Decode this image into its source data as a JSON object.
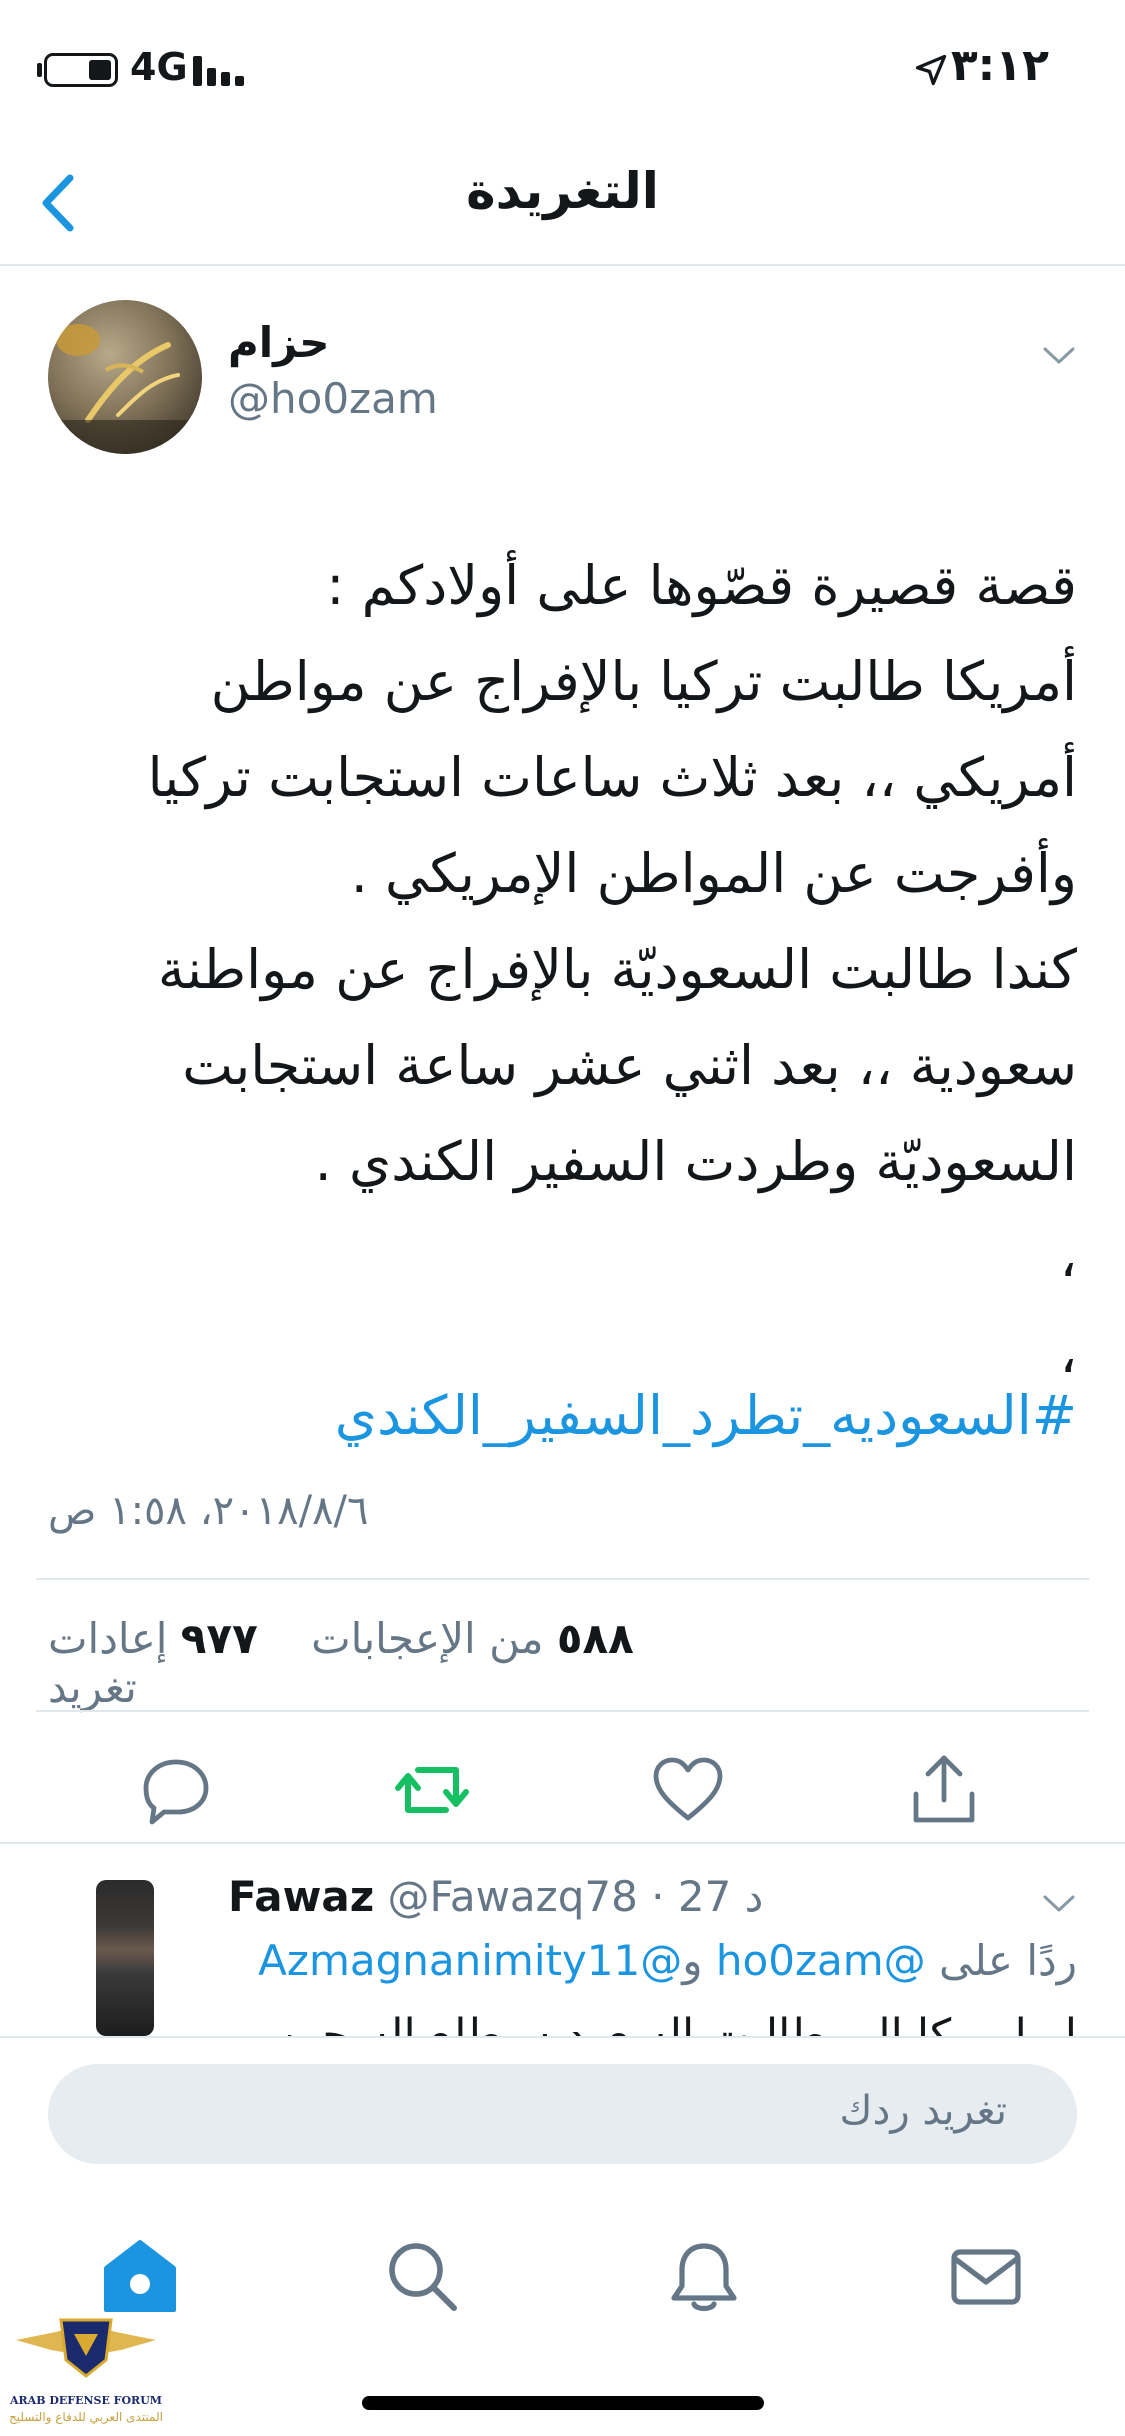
{
  "status_bar": {
    "network": "4G",
    "time": "٣:١٢"
  },
  "nav": {
    "title": "التغريدة"
  },
  "tweet": {
    "display_name": "حزام",
    "handle": "@ho0zam",
    "text": "قصة قصيرة قصّوها على أولادكم :\nأمريكا طالبت تركيا بالإفراج عن مواطن\nأمريكي ،، بعد ثلاث ساعات استجابت تركيا\nوأفرجت عن المواطن الإمريكي .\nكندا طالبت السعوديّة بالإفراج عن مواطنة\nسعودية ،، بعد اثني عشر ساعة استجابت\nالسعوديّة وطردت السفير الكندي .\n،\n،",
    "hashtag": "#السعوديه_تطرد_السفير_الكندي",
    "timestamp": "٢٠١٨/٨/٦، ١:٥٨ ص",
    "likes_count": "٥٨٨",
    "likes_label": "من الإعجابات",
    "retweets_count": "٩٧٧",
    "retweets_label": "إعادات تغريد"
  },
  "reply": {
    "name": "Fawaz",
    "handle_and_time": "@Fawazq78 · 27 د",
    "replying_prefix": "ردًا على",
    "mention_1": "@ho0zam",
    "conjunction": "و",
    "mention_2": "@Azmagnanimity11",
    "text": "لو امريكا الي طالبت السعوديه بطلع السجين"
  },
  "compose": {
    "placeholder": "تغريد ردك"
  },
  "watermark": {
    "line1": "ARAB DEFENSE FORUM",
    "line2": "المنتدى العربي للدفاع والتسليح"
  },
  "colors": {
    "accent": "#1b95e0",
    "retweet_active": "#17bf63",
    "muted": "#657786",
    "text": "#14171a"
  }
}
